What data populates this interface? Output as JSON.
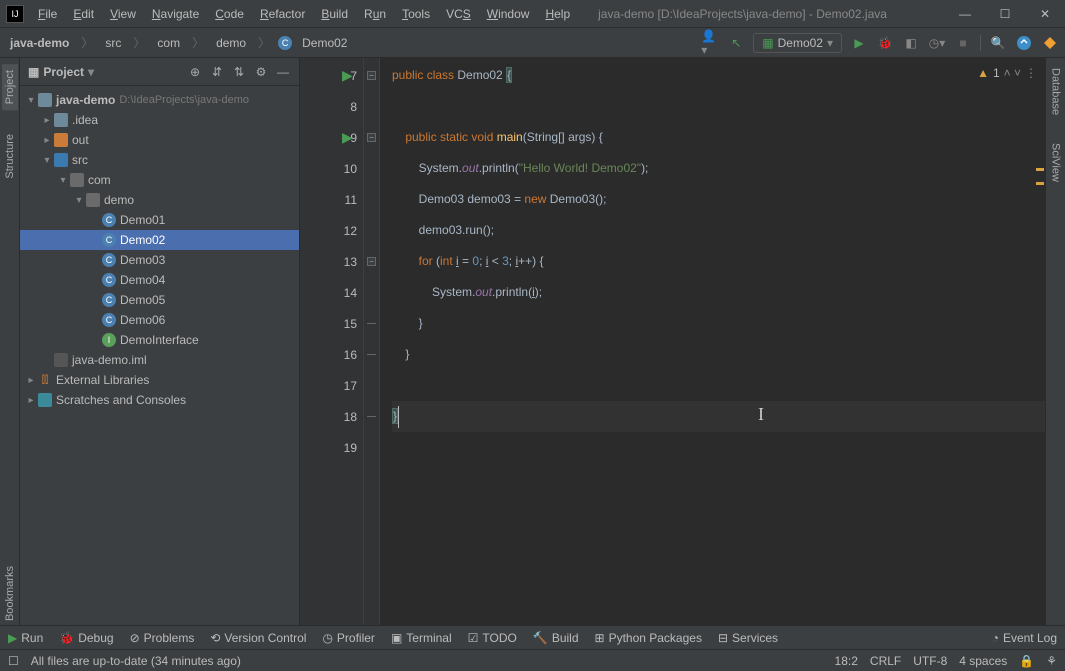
{
  "title": "java-demo [D:\\IdeaProjects\\java-demo] - Demo02.java",
  "menu": [
    "File",
    "Edit",
    "View",
    "Navigate",
    "Code",
    "Refactor",
    "Build",
    "Run",
    "Tools",
    "VCS",
    "Window",
    "Help"
  ],
  "breadcrumbs": {
    "proj": "java-demo",
    "src": "src",
    "pkg1": "com",
    "pkg2": "demo",
    "cls": "Demo02"
  },
  "run_config": "Demo02",
  "panel_title": "Project",
  "tree": {
    "proj": "java-demo",
    "proj_path": "D:\\IdeaProjects\\java-demo",
    "idea": ".idea",
    "out": "out",
    "src": "src",
    "com": "com",
    "demo": "demo",
    "files": [
      "Demo01",
      "Demo02",
      "Demo03",
      "Demo04",
      "Demo05",
      "Demo06"
    ],
    "iface": "DemoInterface",
    "iml": "java-demo.iml",
    "ext": "External Libraries",
    "scratch": "Scratches and Consoles"
  },
  "gutter": {
    "start": 7,
    "end": 19
  },
  "warn_count": "1",
  "code": {
    "l7a": "public class ",
    "l7b": "Demo02 ",
    "l7c": "{",
    "l9a": "    public static void ",
    "l9b": "main",
    "l9c": "(String[] args) {",
    "l10a": "        System.",
    "l10b": "out",
    "l10c": ".println(",
    "l10d": "\"Hello World! Demo02\"",
    "l10e": ");",
    "l11a": "        Demo03 demo03 = ",
    "l11b": "new ",
    "l11c": "Demo03();",
    "l12": "        demo03.run();",
    "l13a": "        for ",
    "l13b": "(",
    "l13c": "int ",
    "l13d": "i",
    " l13e": " = ",
    "l13f": "0",
    "l13g": "; ",
    "l13h": "i",
    "l13i": " < ",
    "l13j": "3",
    "l13k": "; ",
    "l13l": "i",
    "l13m": "++) {",
    "l14a": "            System.",
    "l14b": "out",
    "l14c": ".println(",
    "l14d": "i",
    "l14e": ");",
    "l15": "        }",
    "l16": "    }",
    "l18": "}"
  },
  "bottom": {
    "run": "Run",
    "debug": "Debug",
    "problems": "Problems",
    "vcs": "Version Control",
    "profiler": "Profiler",
    "terminal": "Terminal",
    "todo": "TODO",
    "build": "Build",
    "pypkg": "Python Packages",
    "services": "Services",
    "eventlog": "Event Log"
  },
  "status": {
    "msg": "All files are up-to-date (34 minutes ago)",
    "pos": "18:2",
    "eol": "CRLF",
    "enc": "UTF-8",
    "indent": "4 spaces"
  },
  "left_tabs": {
    "project": "Project",
    "structure": "Structure",
    "bookmarks": "Bookmarks"
  },
  "right_tabs": {
    "database": "Database",
    "sciview": "SciView"
  }
}
